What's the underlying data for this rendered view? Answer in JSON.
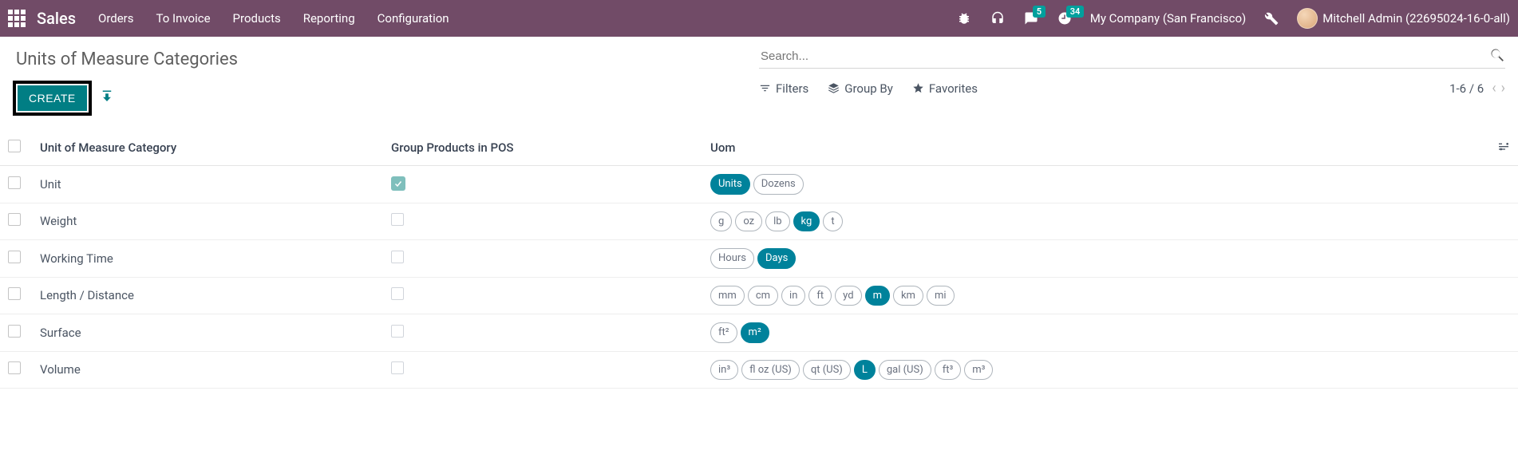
{
  "nav": {
    "brand": "Sales",
    "menu": [
      "Orders",
      "To Invoice",
      "Products",
      "Reporting",
      "Configuration"
    ],
    "company": "My Company (San Francisco)",
    "user": "Mitchell Admin (22695024-16-0-all)",
    "msg_badge": "5",
    "clock_badge": "34"
  },
  "page": {
    "title": "Units of Measure Categories",
    "create_label": "CREATE",
    "search_placeholder": "Search...",
    "filters_label": "Filters",
    "groupby_label": "Group By",
    "favorites_label": "Favorites",
    "pager": "1-6 / 6"
  },
  "table": {
    "headers": {
      "cat": "Unit of Measure Category",
      "pos": "Group Products in POS",
      "uom": "Uom"
    },
    "rows": [
      {
        "cat": "Unit",
        "pos": true,
        "tags": [
          {
            "l": "Units",
            "a": true
          },
          {
            "l": "Dozens",
            "a": false
          }
        ]
      },
      {
        "cat": "Weight",
        "pos": false,
        "tags": [
          {
            "l": "g",
            "a": false
          },
          {
            "l": "oz",
            "a": false
          },
          {
            "l": "lb",
            "a": false
          },
          {
            "l": "kg",
            "a": true
          },
          {
            "l": "t",
            "a": false
          }
        ]
      },
      {
        "cat": "Working Time",
        "pos": false,
        "tags": [
          {
            "l": "Hours",
            "a": false
          },
          {
            "l": "Days",
            "a": true
          }
        ]
      },
      {
        "cat": "Length / Distance",
        "pos": false,
        "tags": [
          {
            "l": "mm",
            "a": false
          },
          {
            "l": "cm",
            "a": false
          },
          {
            "l": "in",
            "a": false
          },
          {
            "l": "ft",
            "a": false
          },
          {
            "l": "yd",
            "a": false
          },
          {
            "l": "m",
            "a": true
          },
          {
            "l": "km",
            "a": false
          },
          {
            "l": "mi",
            "a": false
          }
        ]
      },
      {
        "cat": "Surface",
        "pos": false,
        "tags": [
          {
            "l": "ft²",
            "a": false
          },
          {
            "l": "m²",
            "a": true
          }
        ]
      },
      {
        "cat": "Volume",
        "pos": false,
        "tags": [
          {
            "l": "in³",
            "a": false
          },
          {
            "l": "fl oz (US)",
            "a": false
          },
          {
            "l": "qt (US)",
            "a": false
          },
          {
            "l": "L",
            "a": true
          },
          {
            "l": "gal (US)",
            "a": false
          },
          {
            "l": "ft³",
            "a": false
          },
          {
            "l": "m³",
            "a": false
          }
        ]
      }
    ]
  }
}
